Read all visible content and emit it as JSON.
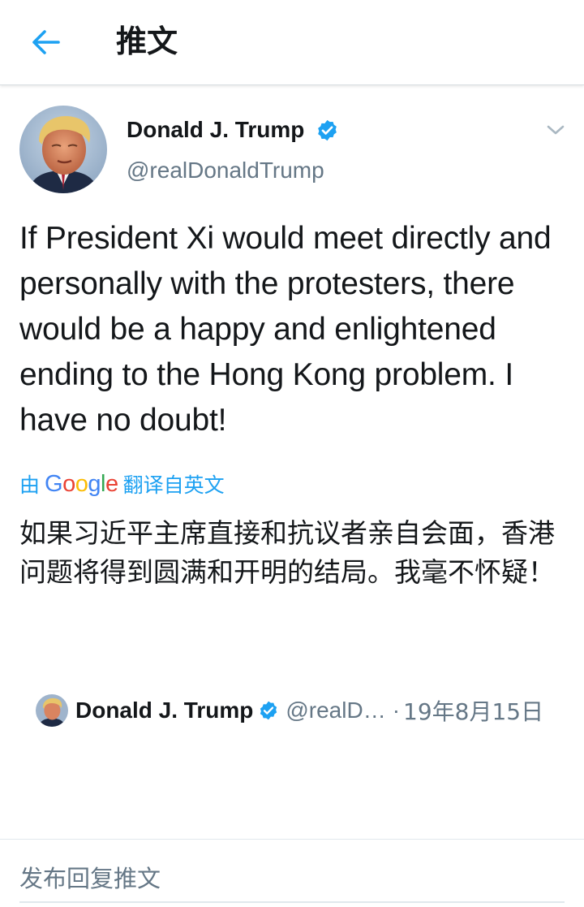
{
  "header": {
    "title": "推文",
    "back_icon": "arrow-left-icon"
  },
  "tweet": {
    "author_name": "Donald J. Trump",
    "author_handle": "@realDonaldTrump",
    "verified_icon": "verified-badge-icon",
    "menu_icon": "chevron-down-icon",
    "text": "If President Xi would meet directly and personally with the protesters, there would be a happy and enlightened ending to the Hong Kong problem. I have no doubt!",
    "translation": {
      "prefix": "由",
      "provider": "Google",
      "suffix": "翻译自英文",
      "text": "如果习近平主席直接和抗议者亲自会面，香港问题将得到圆满和开明的结局。我毫不怀疑！"
    }
  },
  "quoted": {
    "author_name": "Donald J. Trump",
    "author_handle": "@realD…",
    "separator": "·",
    "date": "19年8月15日"
  },
  "reply": {
    "placeholder": "发布回复推文"
  },
  "colors": {
    "accent": "#1da1f2",
    "text_primary": "#14171a",
    "text_secondary": "#657786",
    "google_blue": "#4285F4",
    "google_red": "#EA4335",
    "google_yellow": "#FBBC05",
    "google_green": "#34A853"
  }
}
